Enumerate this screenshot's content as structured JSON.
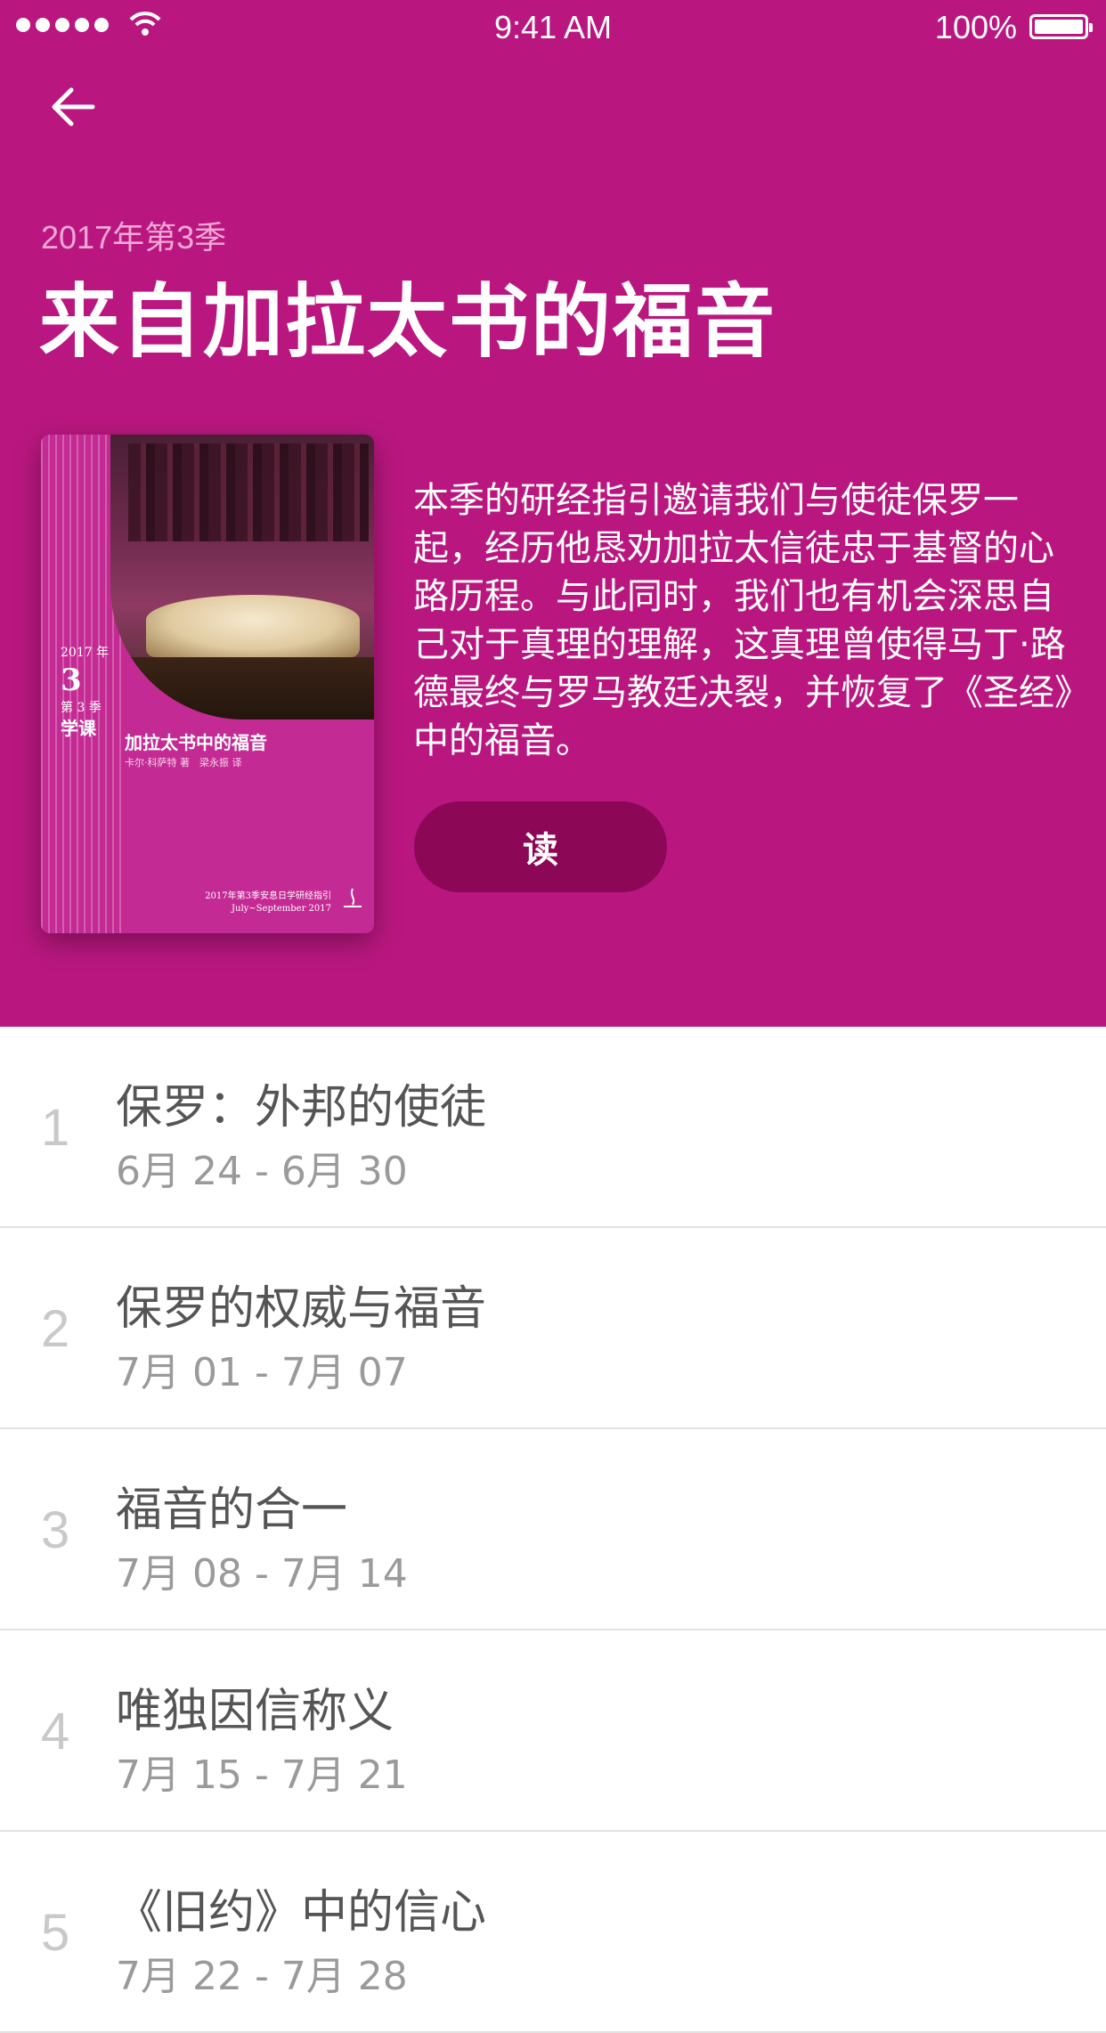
{
  "status_bar": {
    "time": "9:41 AM",
    "battery": "100%"
  },
  "header": {
    "quarter": "2017年第3季",
    "title": "来自加拉太书的福音",
    "description": "本季的研经指引邀请我们与使徒保罗一起，经历他恳劝加拉太信徒忠于基督的心路历程。与此同时，我们也有机会深思自己对于真理的理解，这真理曾使得马丁·路德最终与罗马教廷决裂，并恢复了《圣经》中的福音。",
    "read_label": "读",
    "background_color": "#b9177f",
    "button_color": "#8c0756"
  },
  "cover": {
    "tag_year": "2017 年",
    "tag_number": "3",
    "tag_quarter": "第 3 季",
    "tag_lesson": "学课",
    "title": "加拉太书中的福音",
    "authors": "卡尔·科萨特 著　梁永振 译",
    "footer_cn": "2017年第3季安息日学研经指引",
    "footer_en": "July~September 2017"
  },
  "lessons": [
    {
      "number": "1",
      "title": "保罗：外邦的使徒",
      "dates": "6月 24 - 6月 30"
    },
    {
      "number": "2",
      "title": "保罗的权威与福音",
      "dates": "7月 01 - 7月 07"
    },
    {
      "number": "3",
      "title": "福音的合一",
      "dates": "7月 08 - 7月 14"
    },
    {
      "number": "4",
      "title": "唯独因信称义",
      "dates": "7月 15 - 7月 21"
    },
    {
      "number": "5",
      "title": "《旧约》中的信心",
      "dates": "7月 22 - 7月 28"
    }
  ]
}
